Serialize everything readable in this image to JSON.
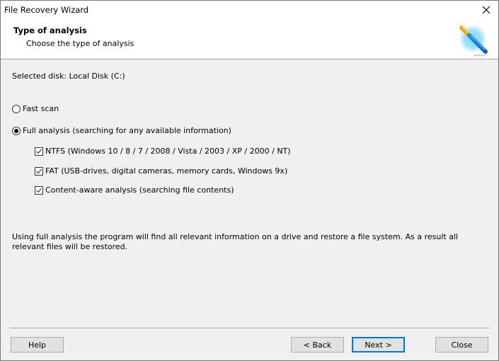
{
  "window": {
    "title": "File Recovery Wizard",
    "close_icon": "close-x-icon"
  },
  "header": {
    "title": "Type of analysis",
    "subtitle": "Choose the type of analysis",
    "icon": "magic-wand-icon"
  },
  "main": {
    "selected_disk": "Selected disk: Local Disk (C:)",
    "analysis_options": [
      {
        "label": "Fast scan",
        "checked": false
      },
      {
        "label": "Full analysis (searching for any available information)",
        "checked": true
      }
    ],
    "filesystem_options": [
      {
        "label": "NTFS (Windows 10 / 8 / 7 / 2008 / Vista / 2003 / XP / 2000 / NT)",
        "checked": true
      },
      {
        "label": "FAT (USB-drives, digital cameras, memory cards, Windows 9x)",
        "checked": true
      },
      {
        "label": "Content-aware analysis (searching file contents)",
        "checked": true
      }
    ],
    "description": "Using full analysis the program will find all relevant information on a drive and restore a file system. As a result all relevant files will be restored."
  },
  "footer": {
    "help_label": "Help",
    "back_label": "< Back",
    "next_label": "Next >",
    "close_label": "Close"
  },
  "colors": {
    "accent": "#0078d7"
  }
}
